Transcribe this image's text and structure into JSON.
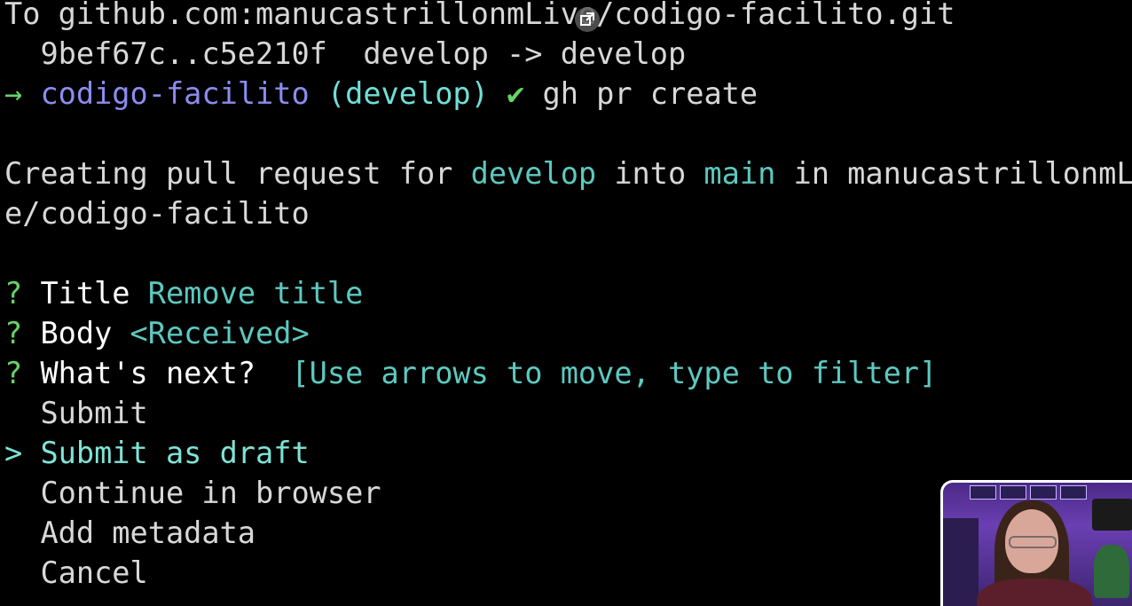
{
  "terminal": {
    "line1": {
      "to_label": "To",
      "remote": "github.com:manucastrillonmLive/codigo-facilito.git"
    },
    "line2": {
      "range": "9bef67c..c5e210f",
      "mapping": "develop -> develop"
    },
    "prompt": {
      "arrow": "→",
      "directory": "codigo-facilito",
      "branch": "(develop)",
      "check": "✔",
      "command": "gh pr create"
    },
    "creating": {
      "prefix": "Creating pull request for ",
      "head_branch": "develop",
      "middle": " into ",
      "base_branch": "main",
      "suffix": " in manucastrillonmLiv",
      "wrap": "e/codigo-facilito"
    },
    "questions": [
      {
        "mark": "?",
        "label": "Title",
        "value": "Remove title"
      },
      {
        "mark": "?",
        "label": "Body",
        "value": "<Received>"
      },
      {
        "mark": "?",
        "label": "What's next?",
        "value": "[Use arrows to move, type to filter]"
      }
    ],
    "options": [
      {
        "label": "Submit",
        "selected": false
      },
      {
        "label": "Submit as draft",
        "selected": true
      },
      {
        "label": "Continue in browser",
        "selected": false
      },
      {
        "label": "Add metadata",
        "selected": false
      },
      {
        "label": "Cancel",
        "selected": false
      }
    ],
    "selection_marker": ">"
  },
  "overlay": {
    "icon": "external-link-icon"
  },
  "webcam": {
    "icon": "webcam-video-feed"
  },
  "colors": {
    "background": "#000000",
    "text": "#d8d8d8",
    "cyan": "#5cc9c0",
    "purple": "#8c8cf0",
    "green": "#68d268"
  }
}
